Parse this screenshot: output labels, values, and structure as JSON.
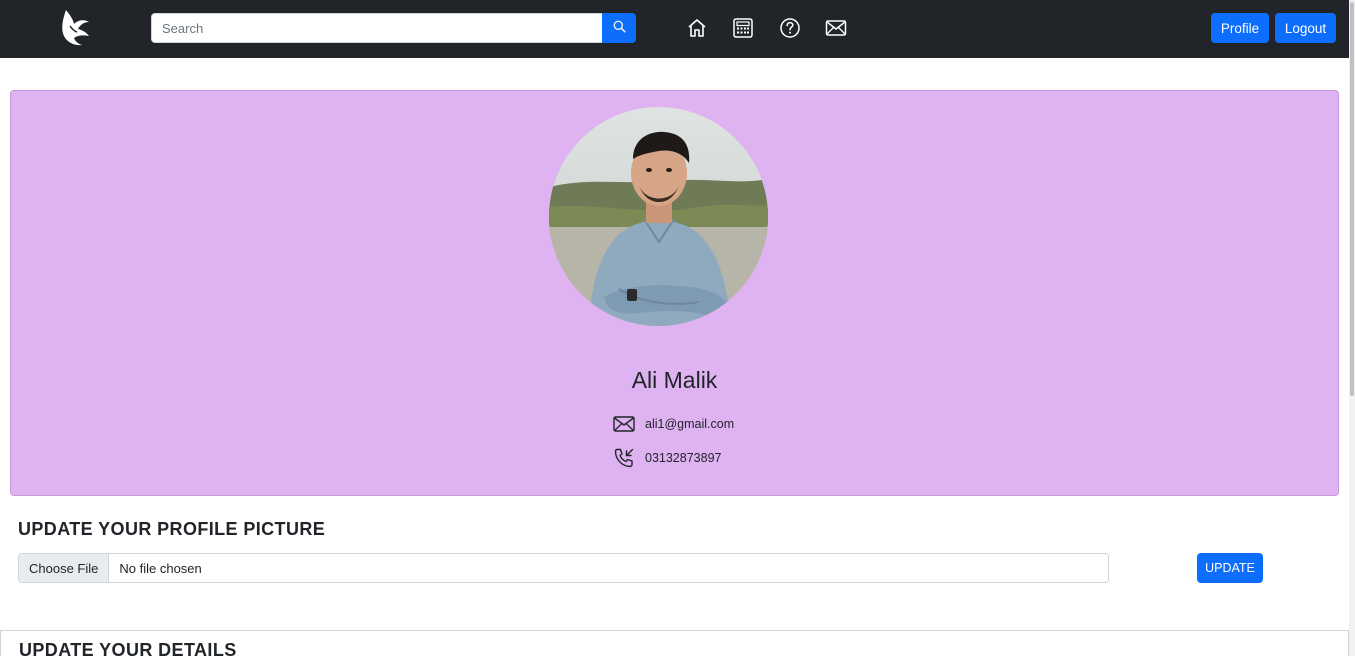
{
  "navbar": {
    "search_placeholder": "Search",
    "icons": [
      "home-icon",
      "calculator-icon",
      "help-icon",
      "mail-icon"
    ],
    "profile_label": "Profile",
    "logout_label": "Logout"
  },
  "profile": {
    "name": "Ali Malik",
    "email": "ali1@gmail.com",
    "phone": "03132873897"
  },
  "update_picture": {
    "title": "UPDATE YOUR PROFILE PICTURE",
    "choose_file_label": "Choose File",
    "file_status": "No file chosen",
    "update_label": "UPDATE"
  },
  "update_details": {
    "title": "UPDATE YOUR DETAILS"
  },
  "colors": {
    "navbar_bg": "#212529",
    "accent": "#0d6efd",
    "card_bg": "#dfb2f1"
  }
}
